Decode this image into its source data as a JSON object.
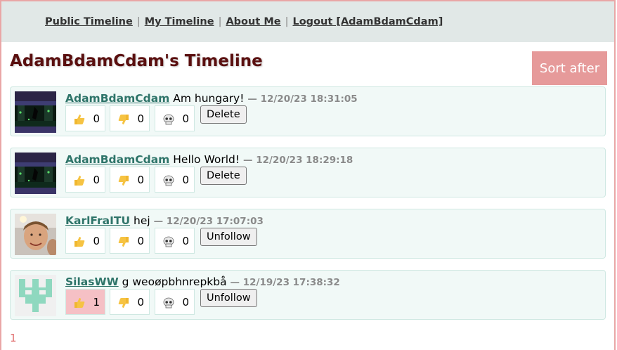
{
  "nav": {
    "public_timeline": "Public Timeline",
    "my_timeline": "My Timeline",
    "about_me": "About Me",
    "logout": "Logout [AdamBdamCdam]",
    "separator": "|"
  },
  "page_title": "AdamBdamCdam's Timeline",
  "sort_button": "Sort after",
  "posts": [
    {
      "username": "AdamBdamCdam",
      "message": "Am hungary!",
      "timestamp": "— 12/20/23 18:31:05",
      "likes": "0",
      "dislikes": "0",
      "skulls": "0",
      "action": "Delete",
      "avatar_icon": "dark-scene-avatar"
    },
    {
      "username": "AdamBdamCdam",
      "message": "Hello World!",
      "timestamp": "— 12/20/23 18:29:18",
      "likes": "0",
      "dislikes": "0",
      "skulls": "0",
      "action": "Delete",
      "avatar_icon": "dark-scene-avatar"
    },
    {
      "username": "KarlFraITU",
      "message": "hej",
      "timestamp": "— 12/20/23 17:07:03",
      "likes": "0",
      "dislikes": "0",
      "skulls": "0",
      "action": "Unfollow",
      "avatar_icon": "photo-avatar"
    },
    {
      "username": "SilasWW",
      "message": "g weoøpbhnrepkbå",
      "timestamp": "— 12/19/23 17:38:32",
      "likes": "1",
      "dislikes": "0",
      "skulls": "0",
      "like_active": true,
      "action": "Unfollow",
      "avatar_icon": "pixel-identicon-avatar"
    }
  ],
  "pagination": {
    "current": "1"
  },
  "colors": {
    "nav_bg": "#e1e8e7",
    "title": "#5a0f0f",
    "sort_button": "#e69a9a",
    "username": "#2e7469",
    "post_bg": "#f1f9f7",
    "active_reaction": "#f5c0c5",
    "pager": "#e06c6c"
  }
}
